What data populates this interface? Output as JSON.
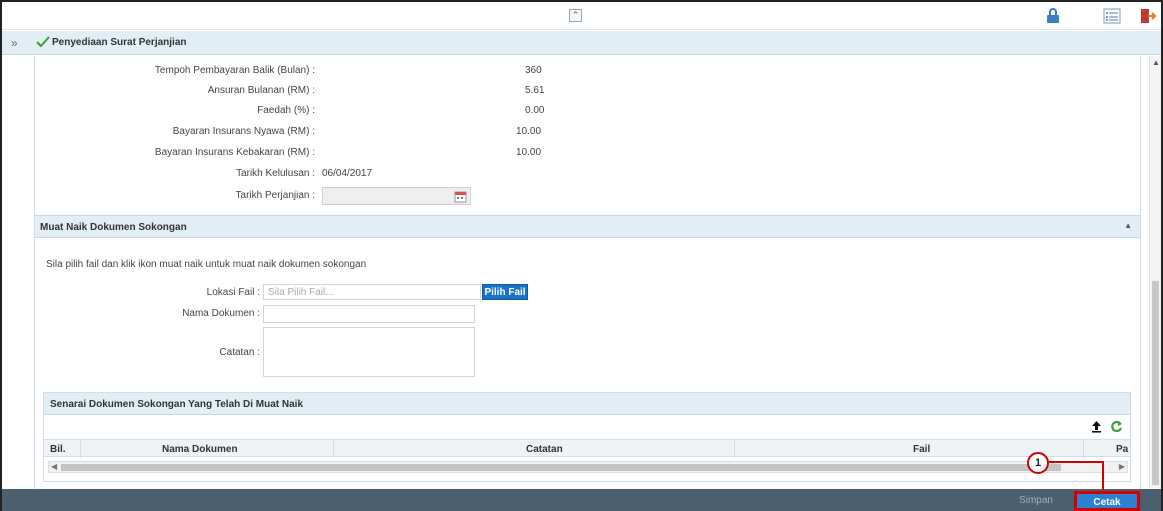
{
  "section": {
    "title": "Penyediaan Surat Perjanjian"
  },
  "fields": [
    {
      "label": "Tempoh Pembayaran Balik (Bulan) :",
      "value": "360"
    },
    {
      "label": "Ansuran Bulanan (RM) :",
      "value": "5.61"
    },
    {
      "label": "Faedah (%) :",
      "value": "0.00"
    },
    {
      "label": "Bayaran Insurans Nyawa (RM) :",
      "value": "10.00"
    },
    {
      "label": "Bayaran Insurans Kebakaran (RM) :",
      "value": "10.00"
    },
    {
      "label": "Tarikh Kelulusan :",
      "value": "06/04/2017"
    },
    {
      "label": "Tarikh Perjanjian :",
      "value": ""
    }
  ],
  "upload": {
    "title": "Muat Naik Dokumen Sokongan",
    "instruction": "Sila pilih fail dan klik ikon muat naik untuk muat naik dokumen sokongan",
    "lokasi_label": "Lokasi Fail :",
    "lokasi_placeholder": "Sila Pilih Fail...",
    "pilih_label": "Pilih Fail",
    "nama_label": "Nama Dokumen :",
    "catatan_label": "Catatan :"
  },
  "list": {
    "title": "Senarai Dokumen Sokongan Yang Telah Di Muat Naik",
    "columns": [
      "Bil.",
      "Nama Dokumen",
      "Catatan",
      "Fail",
      "Pa"
    ]
  },
  "actions": {
    "simpan": "Simpan",
    "cetak": "Cetak"
  },
  "callout": {
    "number": "1"
  },
  "colors": {
    "header_bg": "#e2eef6",
    "primary_button": "#2c82d0",
    "bottom_bar": "#4a6070",
    "highlight": "#d40000"
  }
}
